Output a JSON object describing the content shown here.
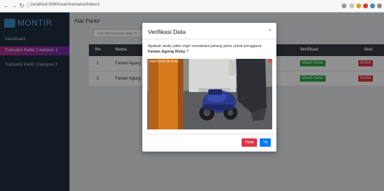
{
  "browser": {
    "url": "localhost:8080/user/transaksi/index/1",
    "back_icon": "arrow-left-icon",
    "forward_icon": "arrow-right-icon",
    "reload_icon": "reload-icon",
    "info_icon": "info-icon"
  },
  "sidebar": {
    "brand": "MONTIR",
    "brand_color": "#6ab0e8",
    "items": [
      {
        "label": "Dashboard"
      },
      {
        "label": "Transaksi Parkir 1 kampus 1"
      },
      {
        "label": "Transaksi Parkir 2 kampus 2"
      }
    ]
  },
  "main": {
    "title": "Alat Parkir",
    "search_placeholder": "Cari Mahasiswa atau Ti",
    "table": {
      "headers": [
        "No",
        "Nama",
        "Verifikasi",
        "Aksi"
      ],
      "rows": [
        {
          "no": "1",
          "nama": "Favian Agung",
          "status": "Masih Parkir",
          "action": "BUKA"
        },
        {
          "no": "2",
          "nama": "Favian Agung",
          "status": "Masih Parkir",
          "action": "BUKA"
        }
      ]
    },
    "colors": {
      "status": "#28a745",
      "action": "#dc3545"
    }
  },
  "modal": {
    "title": "Verifikasi Data",
    "close": "×",
    "message": "Apakah anda yakin ingin membuka palang pintu untuk pengguna",
    "user_name": "Favian Agung Rizky",
    "message_end": " ?",
    "camera_timestamp": "2023-03-01 09:19:06",
    "btn_no": "Tidak",
    "btn_yes": "Ya"
  }
}
